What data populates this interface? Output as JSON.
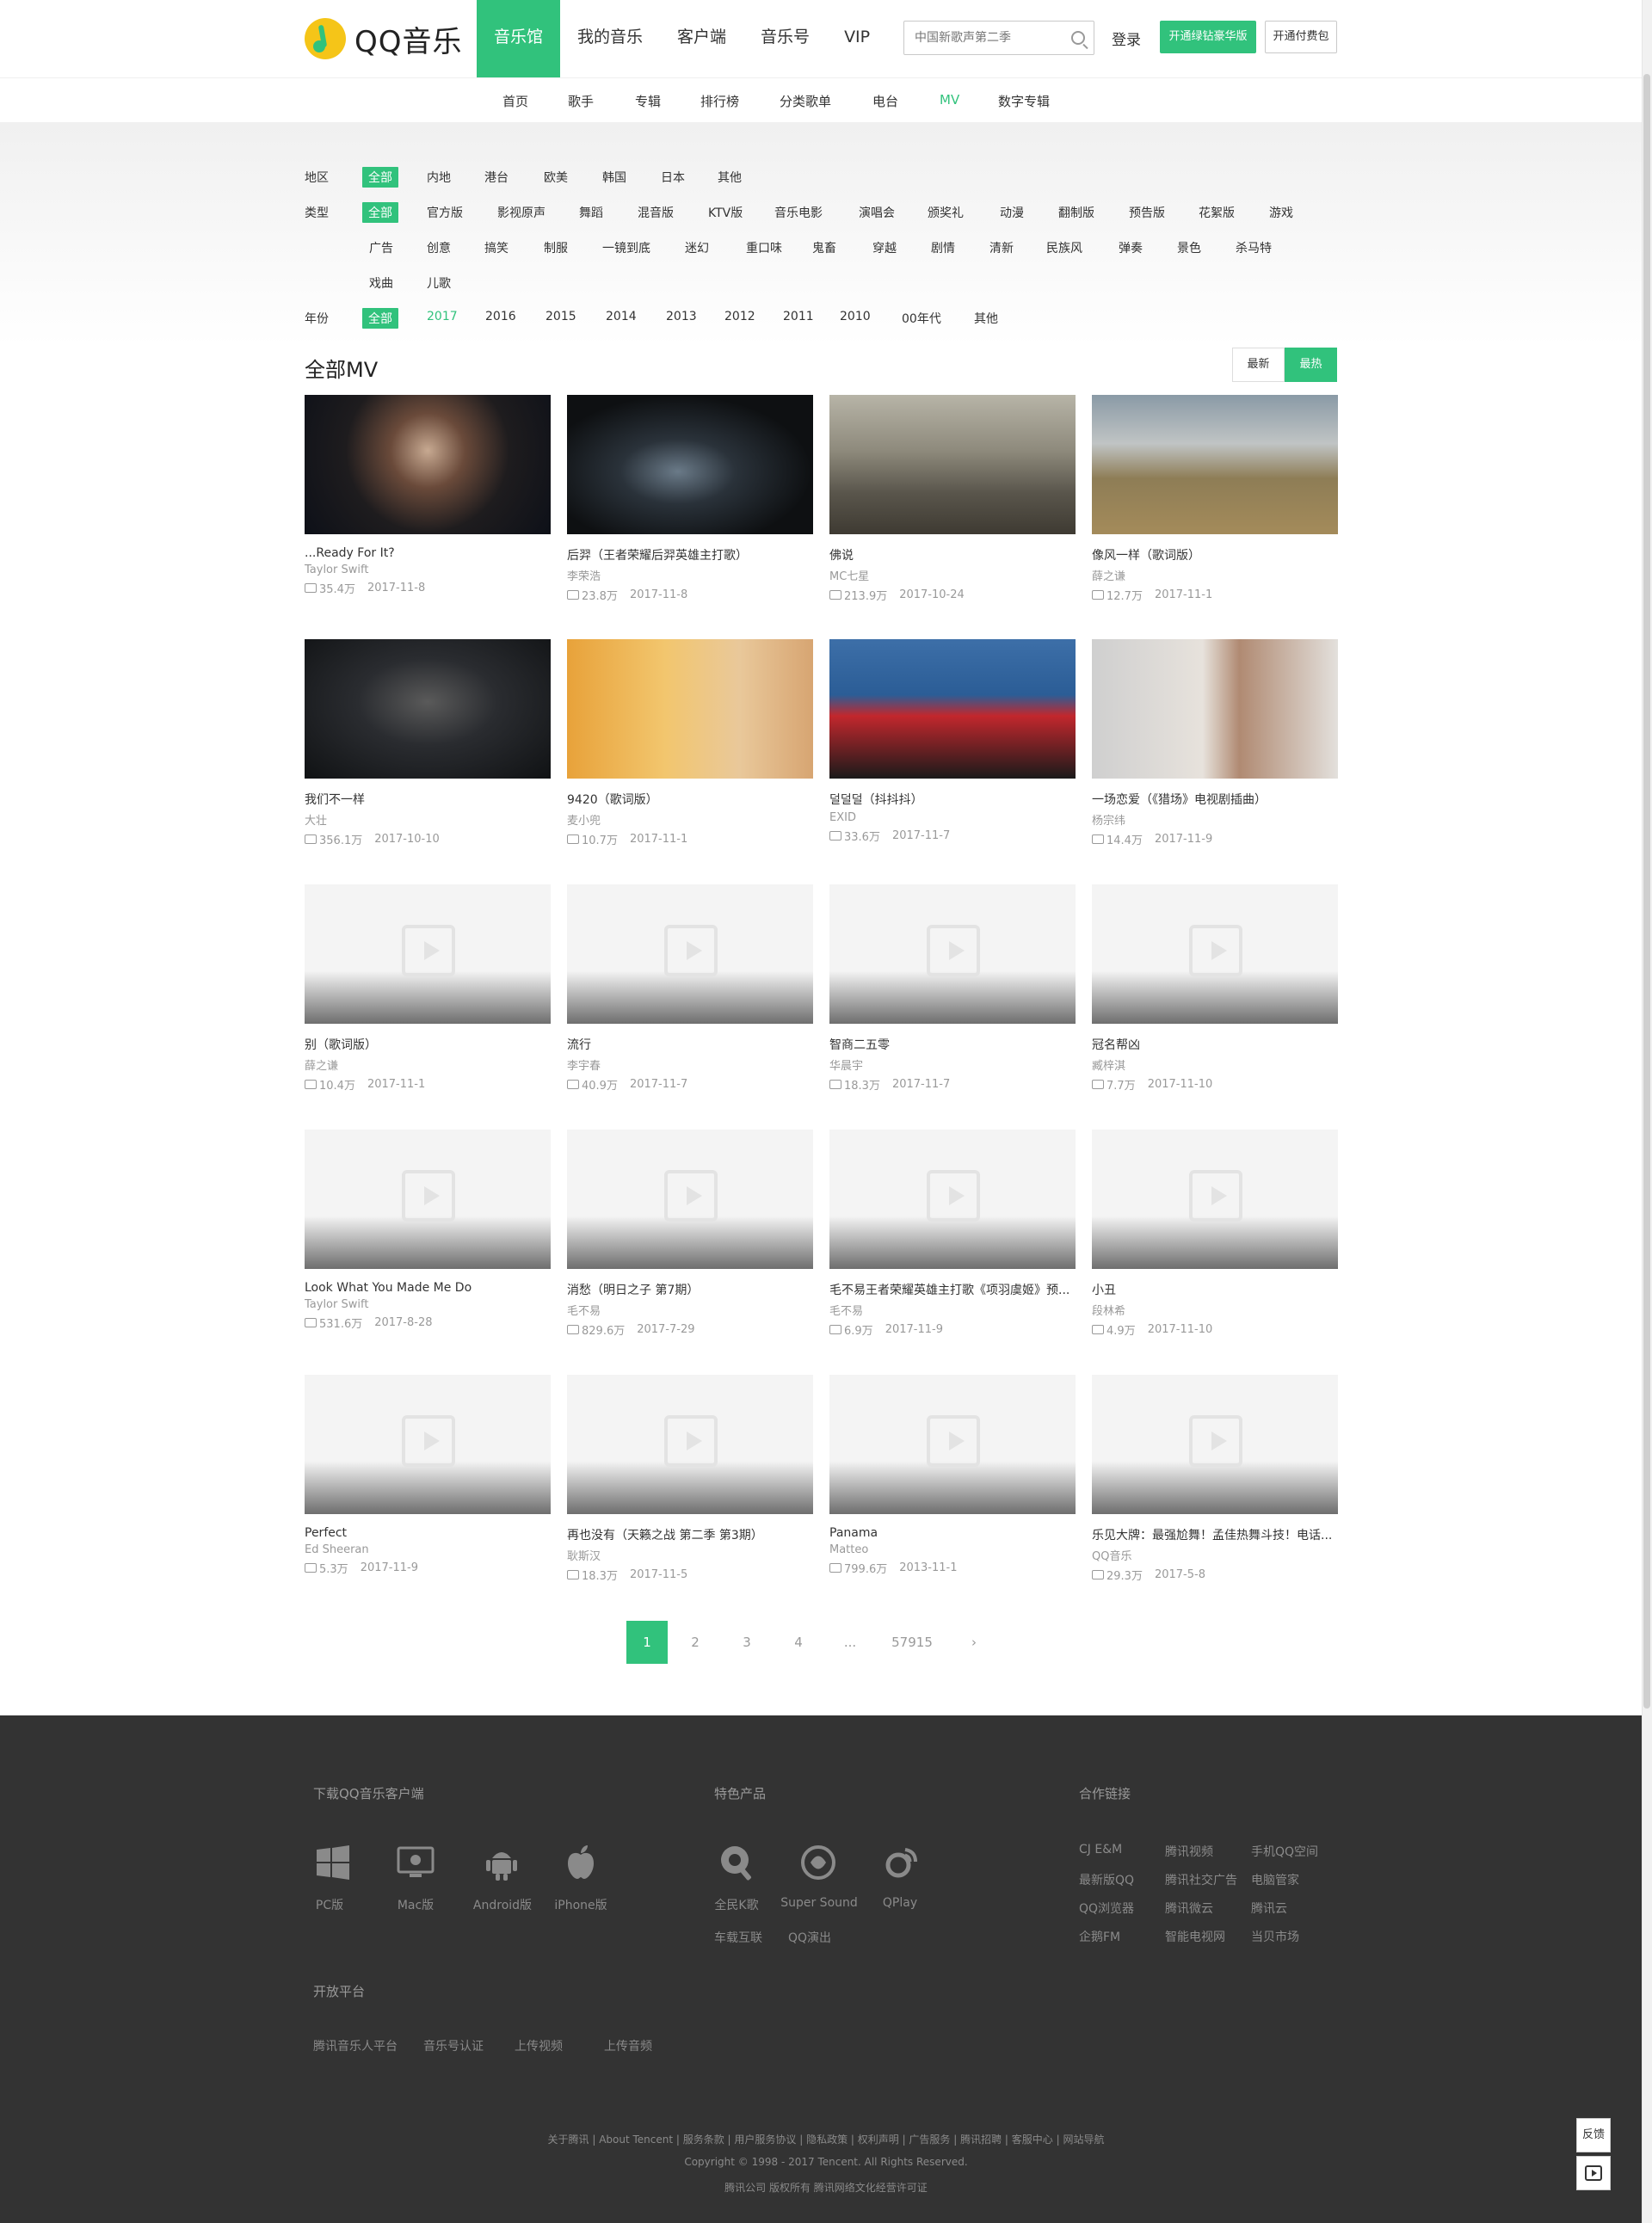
{
  "header": {
    "logo_text": "QQ音乐",
    "nav": [
      "音乐馆",
      "我的音乐",
      "客户端",
      "音乐号",
      "VIP"
    ],
    "search_placeholder": "中国新歌声第二季",
    "login": "登录",
    "vip_button": "开通绿钻豪华版",
    "paid_button": "开通付费包"
  },
  "subnav": [
    "首页",
    "歌手",
    "专辑",
    "排行榜",
    "分类歌单",
    "电台",
    "MV",
    "数字专辑"
  ],
  "subnav_active": "MV",
  "filters": {
    "region": {
      "label": "地区",
      "options": [
        "全部",
        "内地",
        "港台",
        "欧美",
        "韩国",
        "日本",
        "其他"
      ]
    },
    "type": {
      "label": "类型",
      "options": [
        "全部",
        "官方版",
        "影视原声",
        "舞蹈",
        "混音版",
        "KTV版",
        "音乐电影",
        "演唱会",
        "颁奖礼",
        "动漫",
        "翻制版",
        "预告版",
        "花絮版",
        "游戏",
        "广告",
        "创意",
        "搞笑",
        "制服",
        "一镜到底",
        "迷幻",
        "重口味",
        "鬼畜",
        "穿越",
        "剧情",
        "清新",
        "民族风",
        "弹奏",
        "景色",
        "杀马特",
        "戏曲",
        "儿歌"
      ]
    },
    "year": {
      "label": "年份",
      "options": [
        "全部",
        "2017",
        "2016",
        "2015",
        "2014",
        "2013",
        "2012",
        "2011",
        "2010",
        "00年代",
        "其他"
      ]
    }
  },
  "section": {
    "title": "全部MV",
    "sort_new": "最新",
    "sort_hot": "最热"
  },
  "mvs": [
    {
      "title": "...Ready For It?",
      "artist": "Taylor Swift",
      "plays": "35.4万",
      "date": "2017-11-8"
    },
    {
      "title": "后羿（王者荣耀后羿英雄主打歌）",
      "artist": "李荣浩",
      "plays": "23.8万",
      "date": "2017-11-8"
    },
    {
      "title": "佛说",
      "artist": "MC七星",
      "plays": "213.9万",
      "date": "2017-10-24"
    },
    {
      "title": "像风一样（歌词版）",
      "artist": "薛之谦",
      "plays": "12.7万",
      "date": "2017-11-1"
    },
    {
      "title": "我们不一样",
      "artist": "大壮",
      "plays": "356.1万",
      "date": "2017-10-10"
    },
    {
      "title": "9420（歌词版）",
      "artist": "麦小兜",
      "plays": "10.7万",
      "date": "2017-11-1"
    },
    {
      "title": "덜덜덜（抖抖抖）",
      "artist": "EXID",
      "plays": "33.6万",
      "date": "2017-11-7"
    },
    {
      "title": "一场恋爱（《猎场》电视剧插曲）",
      "artist": "杨宗纬",
      "plays": "14.4万",
      "date": "2017-11-9"
    },
    {
      "title": "别（歌词版）",
      "artist": "薛之谦",
      "plays": "10.4万",
      "date": "2017-11-1"
    },
    {
      "title": "流行",
      "artist": "李宇春",
      "plays": "40.9万",
      "date": "2017-11-7"
    },
    {
      "title": "智商二五零",
      "artist": "华晨宇",
      "plays": "18.3万",
      "date": "2017-11-7"
    },
    {
      "title": "冠名帮凶",
      "artist": "臧梓淇",
      "plays": "7.7万",
      "date": "2017-11-10"
    },
    {
      "title": "Look What You Made Me Do",
      "artist": "Taylor Swift",
      "plays": "531.6万",
      "date": "2017-8-28"
    },
    {
      "title": "消愁（明日之子 第7期）",
      "artist": "毛不易",
      "plays": "829.6万",
      "date": "2017-7-29"
    },
    {
      "title": "毛不易王者荣耀英雄主打歌《项羽虞姬》预...",
      "artist": "毛不易",
      "plays": "6.9万",
      "date": "2017-11-9"
    },
    {
      "title": "小丑",
      "artist": "段林希",
      "plays": "4.9万",
      "date": "2017-11-10"
    },
    {
      "title": "Perfect",
      "artist": "Ed Sheeran",
      "plays": "5.3万",
      "date": "2017-11-9"
    },
    {
      "title": "再也没有（天籁之战 第二季 第3期）",
      "artist": "耿斯汉",
      "plays": "18.3万",
      "date": "2017-11-5"
    },
    {
      "title": "Panama",
      "artist": "Matteo",
      "plays": "799.6万",
      "date": "2013-11-1"
    },
    {
      "title": "乐见大牌：最强尬舞！孟佳热舞斗技！电话...",
      "artist": "QQ音乐",
      "plays": "29.3万",
      "date": "2017-5-8"
    }
  ],
  "pager": {
    "pages": [
      "1",
      "2",
      "3",
      "4",
      "...",
      "57915"
    ],
    "next": "›"
  },
  "footer": {
    "download_title": "下载QQ音乐客户端",
    "clients": [
      "PC版",
      "Mac版",
      "Android版",
      "iPhone版"
    ],
    "products_title": "特色产品",
    "products": [
      "全民K歌",
      "Super Sound",
      "QPlay"
    ],
    "products_extra": [
      "车载互联",
      "QQ演出"
    ],
    "partners_title": "合作链接",
    "partners": [
      "CJ E&M",
      "腾讯视频",
      "手机QQ空间",
      "最新版QQ",
      "腾讯社交广告",
      "电脑管家",
      "QQ浏览器",
      "腾讯微云",
      "腾讯云",
      "企鹅FM",
      "智能电视网",
      "当贝市场"
    ],
    "open_title": "开放平台",
    "open_links": [
      "腾讯音乐人平台",
      "音乐号认证",
      "上传视频",
      "上传音频"
    ],
    "bottom_links": "关于腾讯 | About Tencent | 服务条款 | 用户服务协议 | 隐私政策 | 权利声明 | 广告服务 | 腾讯招聘 | 客服中心 | 网站导航",
    "copyright": "Copyright © 1998 - 2017 Tencent. All Rights Reserved.",
    "license": "腾讯公司 版权所有 腾讯网络文化经营许可证"
  },
  "side": {
    "feedback": "反馈"
  }
}
